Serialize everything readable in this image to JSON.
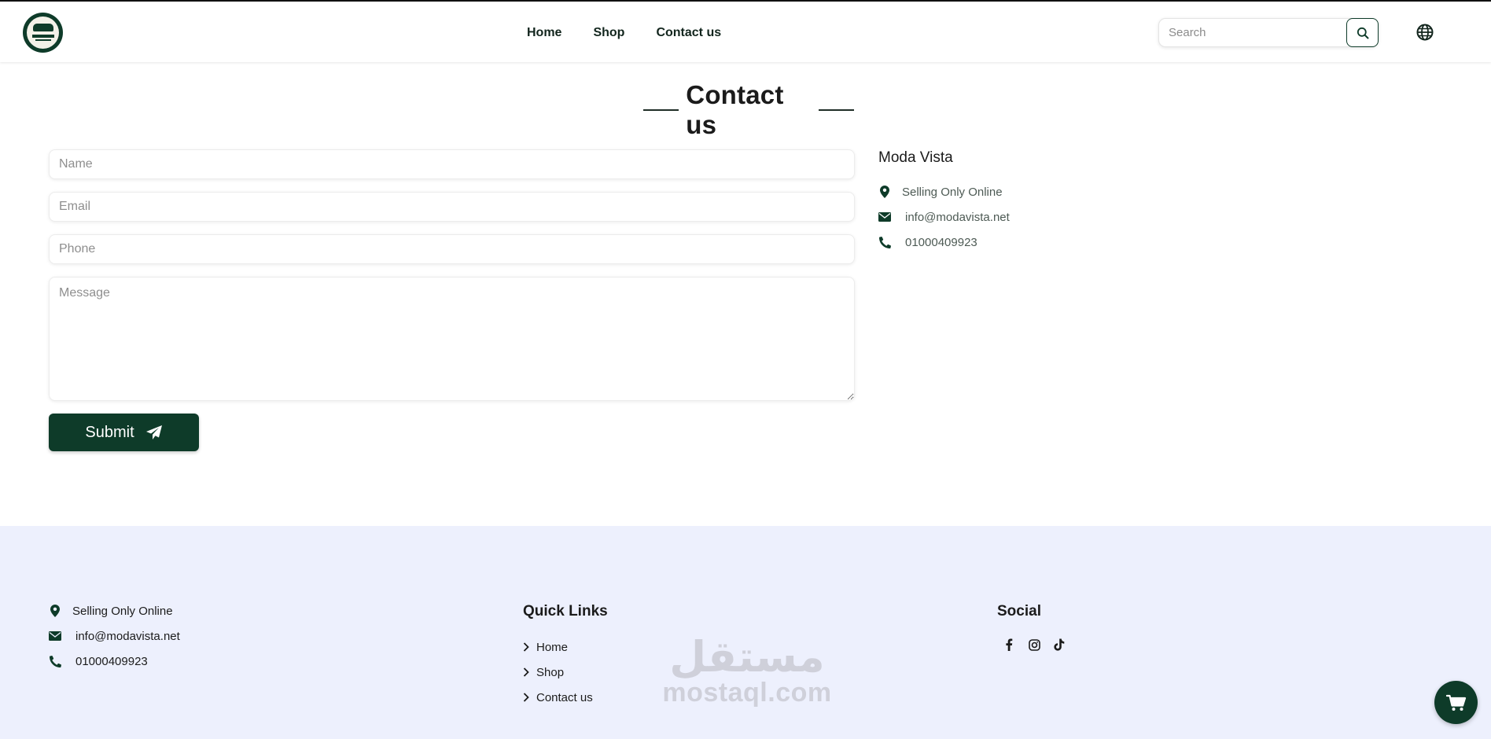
{
  "header": {
    "logo_alt": "Moda Vista",
    "nav": [
      {
        "label": "Home"
      },
      {
        "label": "Shop"
      },
      {
        "label": "Contact us"
      }
    ],
    "search_placeholder": "Search"
  },
  "contact": {
    "title": "Contact us",
    "form": {
      "name_placeholder": "Name",
      "email_placeholder": "Email",
      "phone_placeholder": "Phone",
      "message_placeholder": "Message",
      "submit_label": "Submit"
    },
    "info": {
      "company": "Moda Vista",
      "address": "Selling Only Online",
      "email": "info@modavista.net",
      "phone": "01000409923"
    }
  },
  "footer": {
    "address": "Selling Only Online",
    "email": "info@modavista.net",
    "phone": "01000409923",
    "quick_links_title": "Quick Links",
    "quick_links": [
      {
        "label": "Home"
      },
      {
        "label": "Shop"
      },
      {
        "label": "Contact us"
      }
    ],
    "social_title": "Social",
    "social_icons": [
      "facebook-icon",
      "instagram-icon",
      "tiktok-icon"
    ]
  },
  "watermark": {
    "arabic": "مستقل",
    "latin": "mostaql.com"
  },
  "colors": {
    "brand": "#0e3b29",
    "footer_bg": "#edf0fd"
  }
}
